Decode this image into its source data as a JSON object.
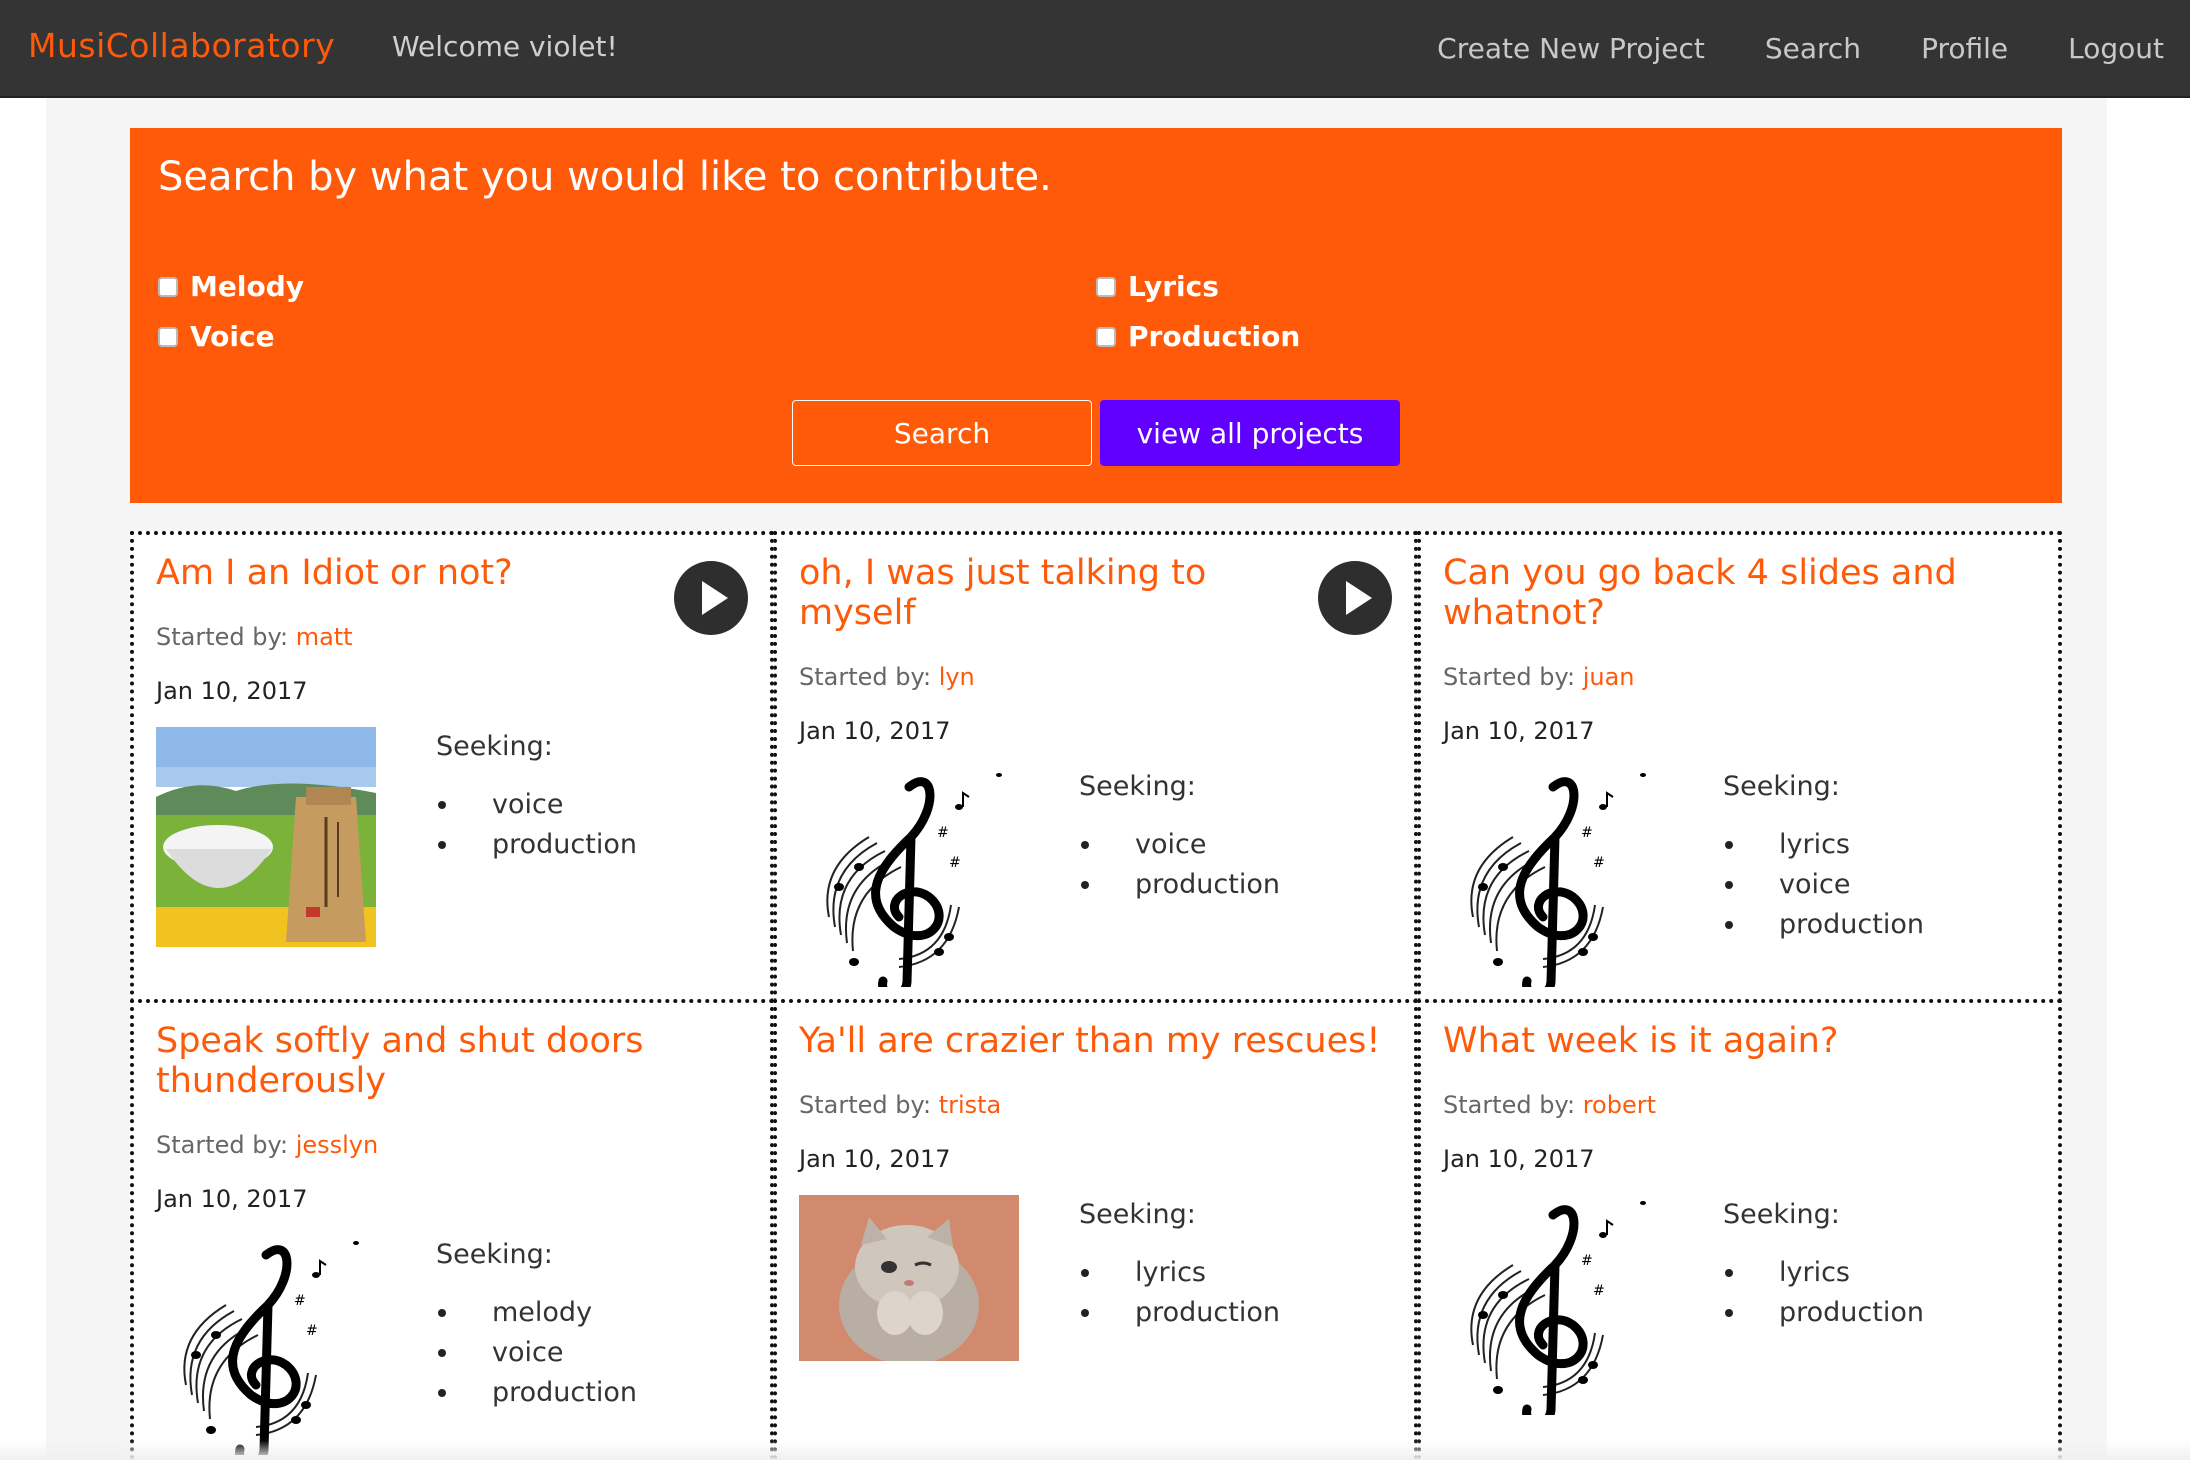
{
  "nav": {
    "brand": "MusiCollaboratory",
    "welcome": "Welcome violet!",
    "links": [
      "Create New Project",
      "Search",
      "Profile",
      "Logout"
    ]
  },
  "search": {
    "title": "Search by what you would like to contribute.",
    "options": [
      "Melody",
      "Lyrics",
      "Voice",
      "Production"
    ],
    "search_button": "Search",
    "view_all_button": "view all projects"
  },
  "colors": {
    "accent": "#ff5a09",
    "navbar": "#343434",
    "view_all": "#6200ff"
  },
  "cards": [
    {
      "title": "Am I an Idiot or not?",
      "started_label": "Started by:",
      "user": "matt",
      "date": "Jan 10, 2017",
      "seeking_label": "Seeking:",
      "seeking": [
        "voice",
        "production"
      ],
      "image": "rice-bag-photo",
      "play": true
    },
    {
      "title": "oh, I was just talking to myself",
      "started_label": "Started by:",
      "user": "lyn",
      "date": "Jan 10, 2017",
      "seeking_label": "Seeking:",
      "seeking": [
        "voice",
        "production"
      ],
      "image": "treble-clef",
      "play": true
    },
    {
      "title": "Can you go back 4 slides and whatnot?",
      "started_label": "Started by:",
      "user": "juan",
      "date": "Jan 10, 2017",
      "seeking_label": "Seeking:",
      "seeking": [
        "lyrics",
        "voice",
        "production"
      ],
      "image": "treble-clef",
      "play": false
    },
    {
      "title": "Speak softly and shut doors thunderously",
      "started_label": "Started by:",
      "user": "jesslyn",
      "date": "Jan 10, 2017",
      "seeking_label": "Seeking:",
      "seeking": [
        "melody",
        "voice",
        "production"
      ],
      "image": "treble-clef",
      "play": false
    },
    {
      "title": "Ya'll are crazier than my rescues!",
      "started_label": "Started by:",
      "user": "trista",
      "date": "Jan 10, 2017",
      "seeking_label": "Seeking:",
      "seeking": [
        "lyrics",
        "production"
      ],
      "image": "kitten-photo",
      "play": false
    },
    {
      "title": "What week is it again?",
      "started_label": "Started by:",
      "user": "robert",
      "date": "Jan 10, 2017",
      "seeking_label": "Seeking:",
      "seeking": [
        "lyrics",
        "production"
      ],
      "image": "treble-clef",
      "play": false
    }
  ]
}
